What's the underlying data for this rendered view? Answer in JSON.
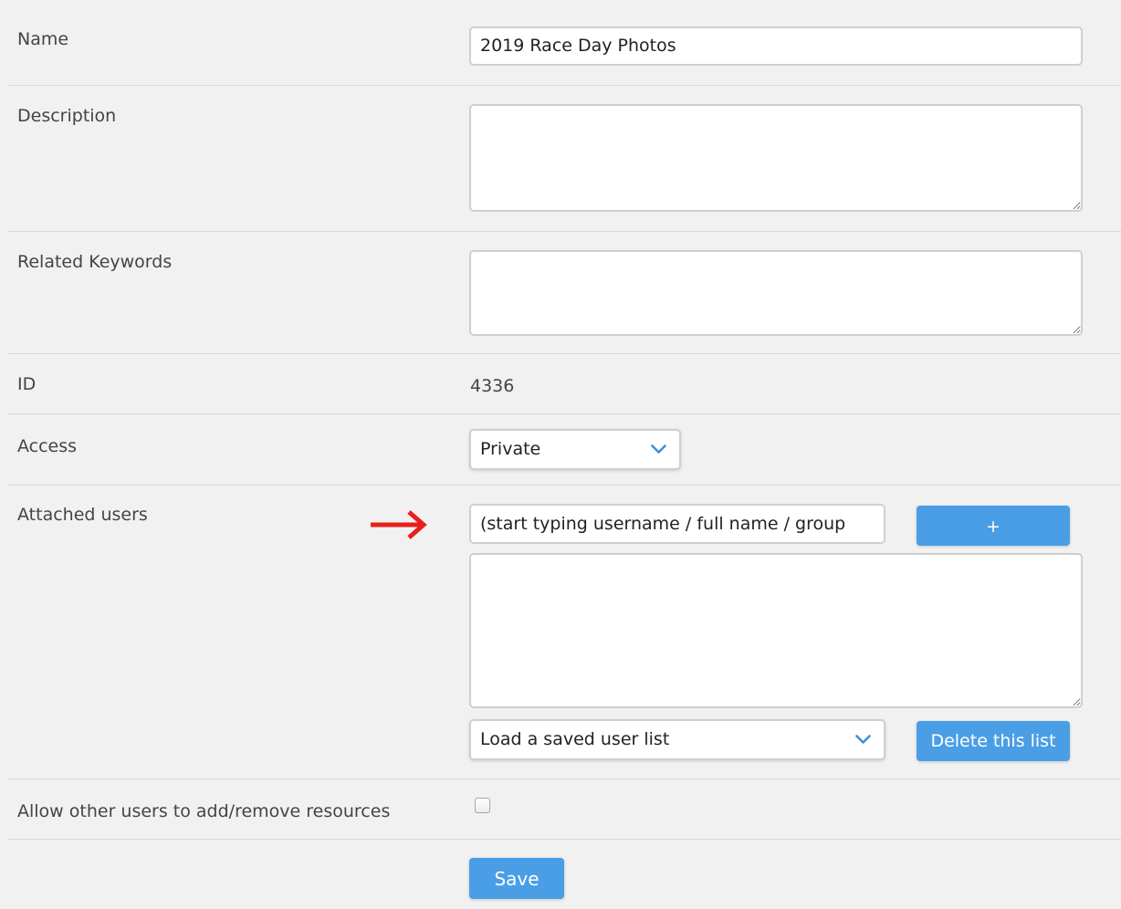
{
  "form": {
    "name": {
      "label": "Name",
      "value": "2019 Race Day Photos"
    },
    "description": {
      "label": "Description",
      "value": ""
    },
    "related_keywords": {
      "label": "Related Keywords",
      "value": ""
    },
    "id": {
      "label": "ID",
      "value": "4336"
    },
    "access": {
      "label": "Access",
      "selected": "Private"
    },
    "attached_users": {
      "label": "Attached users",
      "search_placeholder": "(start typing username / full name / group",
      "add_button_label": "+",
      "users_list_value": "",
      "saved_list_selected": "Load a saved user list",
      "delete_list_button_label": "Delete this list",
      "arrow_color": "#e8201c"
    },
    "allow_others": {
      "label": "Allow other users to add/remove resources",
      "checked": false
    },
    "save_button_label": "Save"
  },
  "colors": {
    "background": "#f1f1f1",
    "accent": "#4a9ee6",
    "chevron": "#3d8fdc"
  }
}
